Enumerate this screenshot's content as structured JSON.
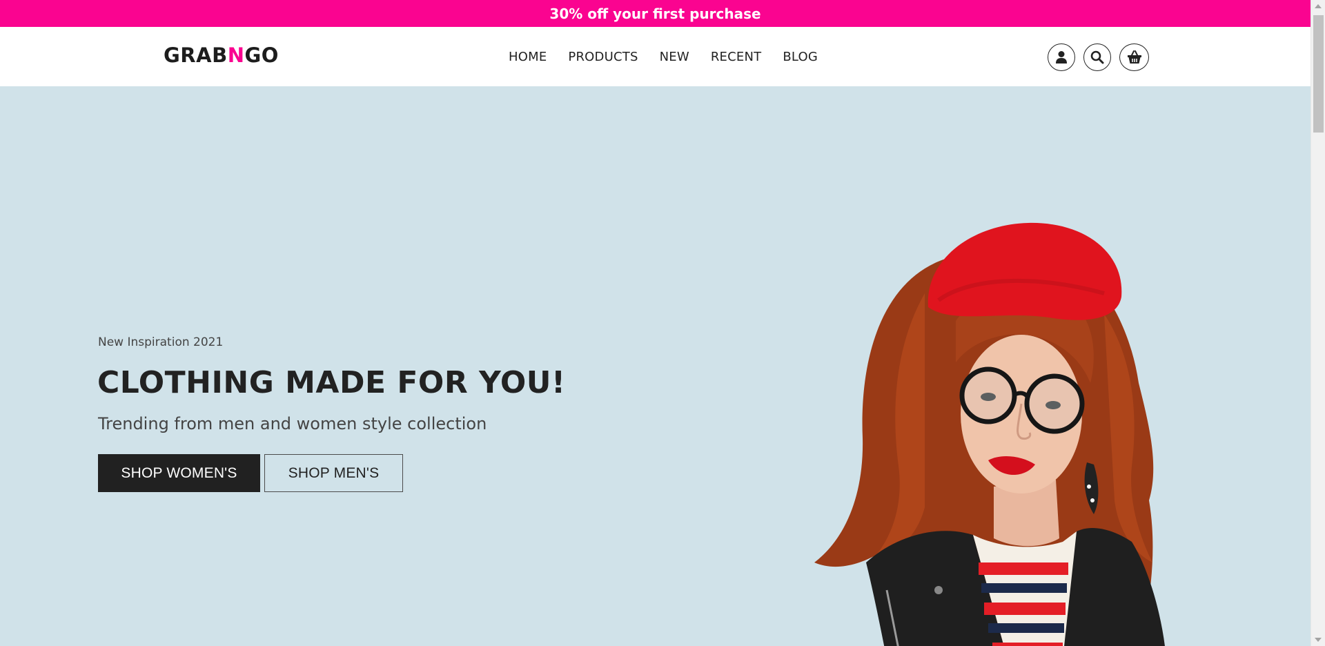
{
  "promo": {
    "text": "30% off your first purchase"
  },
  "brand": {
    "prefix": "GRAB",
    "highlight": "N",
    "suffix": "GO"
  },
  "nav": [
    {
      "label": "HOME"
    },
    {
      "label": "PRODUCTS"
    },
    {
      "label": "NEW"
    },
    {
      "label": "RECENT"
    },
    {
      "label": "BLOG"
    }
  ],
  "header_icons": [
    "user-icon",
    "search-icon",
    "basket-icon"
  ],
  "hero": {
    "eyebrow": "New Inspiration 2021",
    "headline": "CLOTHING MADE FOR YOU!",
    "subline": "Trending from men and women style collection",
    "primary_button": "SHOP WOMEN'S",
    "secondary_button": "SHOP MEN'S"
  },
  "colors": {
    "accent": "#fa0490",
    "hero_bg": "#d0e2e9",
    "button_dark": "#212121",
    "text_dark": "#222222"
  }
}
